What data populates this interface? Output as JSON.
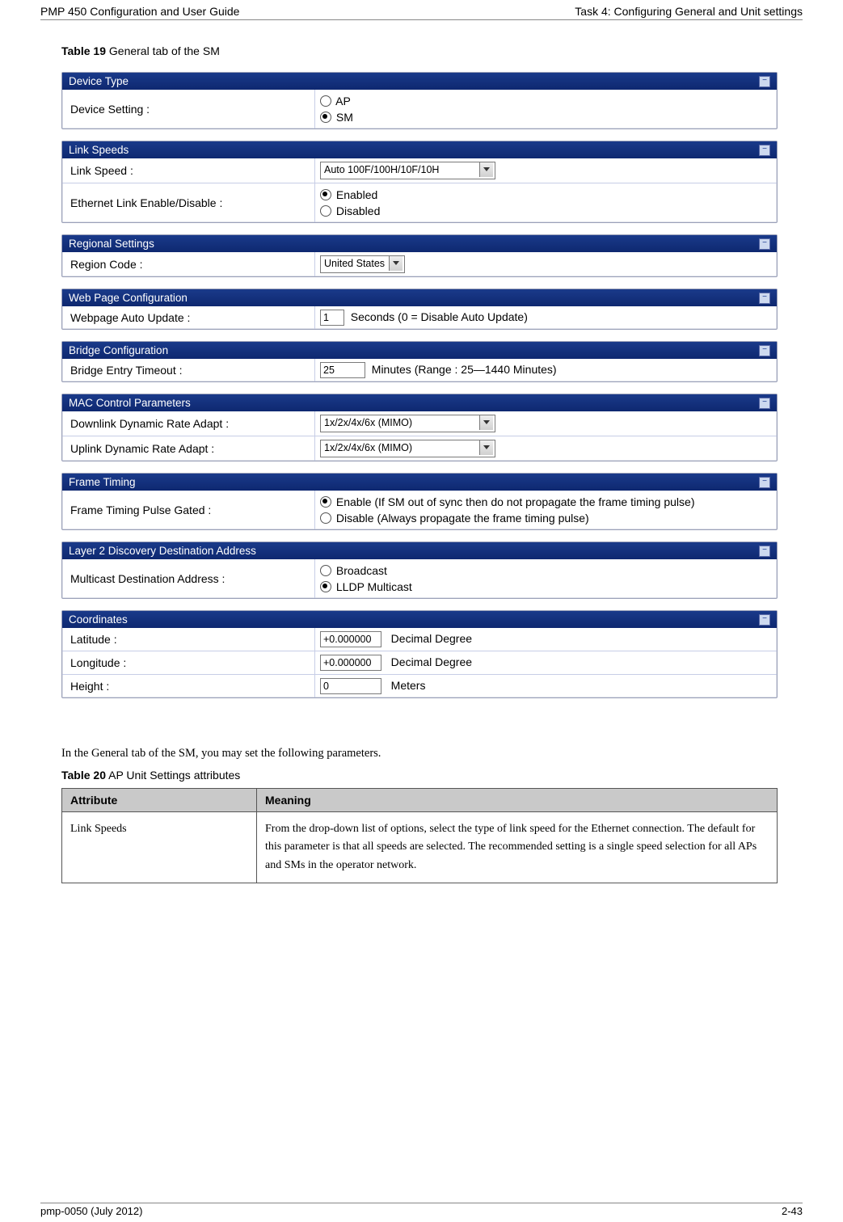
{
  "header": {
    "left": "PMP 450 Configuration and User Guide",
    "right": "Task 4: Configuring General and Unit settings"
  },
  "caption19": {
    "bold": "Table 19",
    "rest": "  General tab of the SM"
  },
  "panels": {
    "device_type": {
      "title": "Device Type",
      "setting_label": "Device Setting :",
      "opt_ap": "AP",
      "opt_sm": "SM"
    },
    "link_speeds": {
      "title": "Link Speeds",
      "speed_label": "Link Speed :",
      "speed_value": "Auto 100F/100H/10F/10H",
      "enable_label": "Ethernet Link Enable/Disable :",
      "opt_enabled": "Enabled",
      "opt_disabled": "Disabled"
    },
    "regional": {
      "title": "Regional Settings",
      "code_label": "Region Code :",
      "code_value": "United States"
    },
    "webpage": {
      "title": "Web Page Configuration",
      "update_label": "Webpage Auto Update :",
      "update_value": "1",
      "update_suffix": "Seconds (0 = Disable Auto Update)"
    },
    "bridge": {
      "title": "Bridge Configuration",
      "timeout_label": "Bridge Entry Timeout :",
      "timeout_value": "25",
      "timeout_suffix": "Minutes (Range : 25—1440 Minutes)"
    },
    "mac": {
      "title": "MAC Control Parameters",
      "down_label": "Downlink Dynamic Rate Adapt :",
      "down_value": "1x/2x/4x/6x (MIMO)",
      "up_label": "Uplink Dynamic Rate Adapt :",
      "up_value": "1x/2x/4x/6x (MIMO)"
    },
    "frame": {
      "title": "Frame Timing",
      "gated_label": "Frame Timing Pulse Gated :",
      "opt_enable": "Enable (If SM out of sync then do not propagate the frame timing pulse)",
      "opt_disable": "Disable (Always propagate the frame timing pulse)"
    },
    "layer2": {
      "title": "Layer 2 Discovery Destination Address",
      "dest_label": "Multicast Destination Address :",
      "opt_broadcast": "Broadcast",
      "opt_lldp": "LLDP Multicast"
    },
    "coords": {
      "title": "Coordinates",
      "lat_label": "Latitude :",
      "lat_value": "+0.000000",
      "lat_suffix": "Decimal Degree",
      "lon_label": "Longitude :",
      "lon_value": "+0.000000",
      "lon_suffix": "Decimal Degree",
      "height_label": "Height :",
      "height_value": "0",
      "height_suffix": "Meters"
    }
  },
  "body_para": "In the General tab of the SM, you may set the following parameters.",
  "caption20": {
    "bold": "Table 20",
    "rest": "  AP Unit Settings attributes"
  },
  "table20": {
    "h1": "Attribute",
    "h2": "Meaning",
    "r1c1": "Link Speeds",
    "r1c2": "From the drop-down list of options, select the type of link speed for the Ethernet connection. The default for this parameter is that all speeds are selected. The recommended setting is a single speed selection for all APs and SMs in the operator network."
  },
  "footer": {
    "left": "pmp-0050 (July 2012)",
    "right": "2-43"
  }
}
